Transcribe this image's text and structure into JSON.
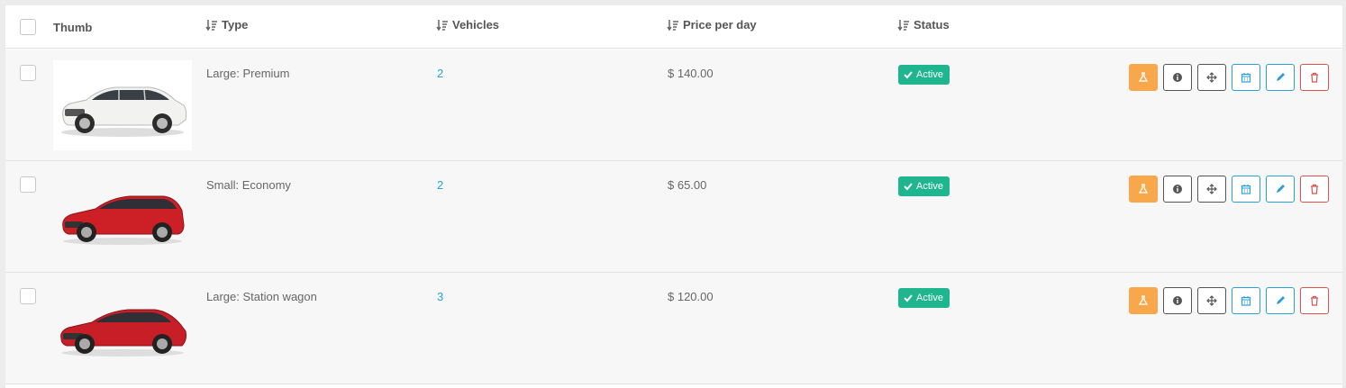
{
  "columns": {
    "thumb": "Thumb",
    "type": "Type",
    "vehicles": "Vehicles",
    "price": "Price per day",
    "status": "Status"
  },
  "rows": [
    {
      "type": "Large: Premium",
      "vehicles": "2",
      "price": "$ 140.00",
      "status": "Active",
      "car_color": "#f2f2f0",
      "car_image": "white-sedan"
    },
    {
      "type": "Small: Economy",
      "vehicles": "2",
      "price": "$ 65.00",
      "status": "Active",
      "car_color": "#cc1f26",
      "car_image": "red-hatchback"
    },
    {
      "type": "Large: Station wagon",
      "vehicles": "3",
      "price": "$ 120.00",
      "status": "Active",
      "car_color": "#c81e28",
      "car_image": "red-sedan"
    }
  ],
  "actions": [
    "flask-icon",
    "info-icon",
    "move-icon",
    "calendar-icon",
    "pencil-icon",
    "trash-icon"
  ],
  "colors": {
    "active": "#1fb58f",
    "link": "#2a9fd6",
    "warning": "#f8a84b",
    "danger": "#d9534f"
  }
}
